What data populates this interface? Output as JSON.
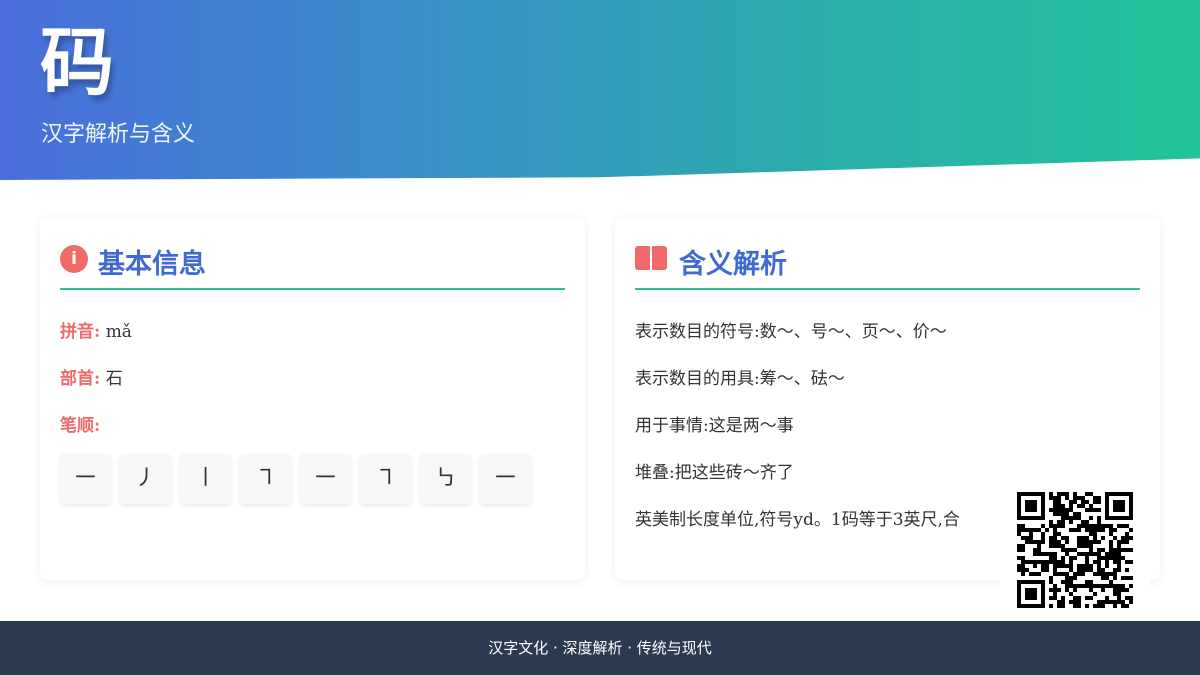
{
  "header": {
    "character": "码",
    "subtitle": "汉字解析与含义"
  },
  "basic": {
    "title": "基本信息",
    "pinyin_label": "拼音:",
    "pinyin": "mǎ",
    "radical_label": "部首:",
    "radical": "石",
    "stroke_label": "笔顺:",
    "strokes": [
      "㇐",
      "㇓",
      "㇑",
      "㇕",
      "㇐",
      "㇕",
      "㇉",
      "㇐"
    ]
  },
  "meanings": {
    "title": "含义解析",
    "items": [
      "表示数目的符号:数～、号～、页～、价～",
      "表示数目的用具:筹～、砝～",
      "用于事情:这是两～事",
      "堆叠:把这些砖～齐了",
      "英美制长度单位,符号yd。1码等于3英尺,合"
    ]
  },
  "footer": {
    "text": "汉字文化 · 深度解析 · 传统与现代"
  }
}
